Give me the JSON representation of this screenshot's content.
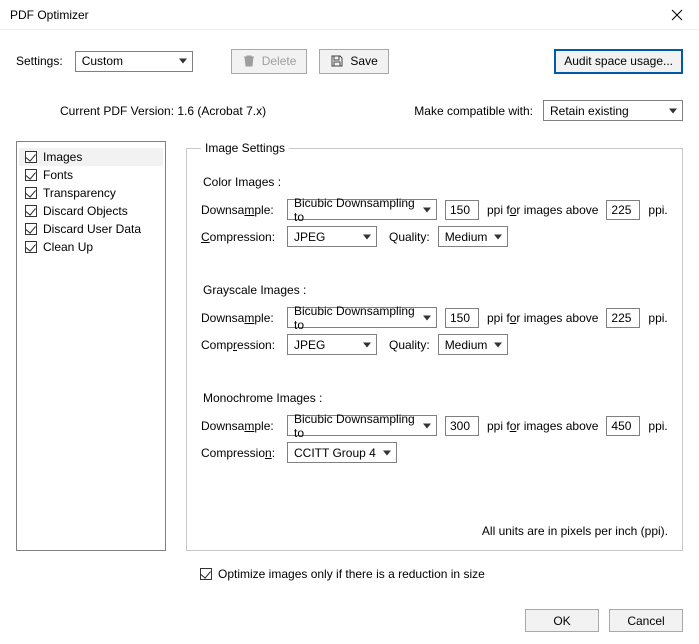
{
  "window": {
    "title": "PDF Optimizer"
  },
  "settings": {
    "label": "Settings:",
    "value": "Custom",
    "delete": "Delete",
    "save": "Save",
    "audit": "Audit space usage..."
  },
  "version": {
    "label": "Current PDF Version: 1.6 (Acrobat 7.x)",
    "make_compat_label": "Make compatible with:",
    "make_compat_value": "Retain existing"
  },
  "sidebar": {
    "items": [
      {
        "label": "Images"
      },
      {
        "label": "Fonts"
      },
      {
        "label": "Transparency"
      },
      {
        "label": "Discard Objects"
      },
      {
        "label": "Discard User Data"
      },
      {
        "label": "Clean Up"
      }
    ]
  },
  "panel": {
    "legend": "Image Settings",
    "color_title": "Color Images :",
    "gray_title": "Grayscale Images :",
    "mono_title": "Monochrome Images :",
    "downsample_label_pre": "Downsa",
    "downsample_label_ul": "m",
    "downsample_label_post": "ple:",
    "downsample_value": "Bicubic Downsampling to",
    "compression_label_ul": "C",
    "compression_label_post": "ompression:",
    "compression_gray_pre": "Comp",
    "compression_gray_ul": "r",
    "compression_gray_post": "ession:",
    "compression_mono_pre": "Compressio",
    "compression_mono_ul": "n",
    "compression_mono_post": ":",
    "compression_value": "JPEG",
    "quality_label": "Quality:",
    "quality_value": "Medium",
    "ppi_mid_pre": "ppi f",
    "ppi_mid_ul": "o",
    "ppi_mid_post": "r images above",
    "ppi_trail": "ppi.",
    "color_ds_ppi": "150",
    "color_above_ppi": "225",
    "gray_ds_ppi": "150",
    "gray_above_ppi": "225",
    "mono_ds_ppi": "300",
    "mono_above_ppi": "450",
    "ccitt_value": "CCITT Group 4",
    "units_note": "All units are in pixels per inch (ppi)."
  },
  "footer": {
    "optimize_only": "Optimize images only if there is a reduction in size",
    "ok": "OK",
    "cancel": "Cancel"
  }
}
